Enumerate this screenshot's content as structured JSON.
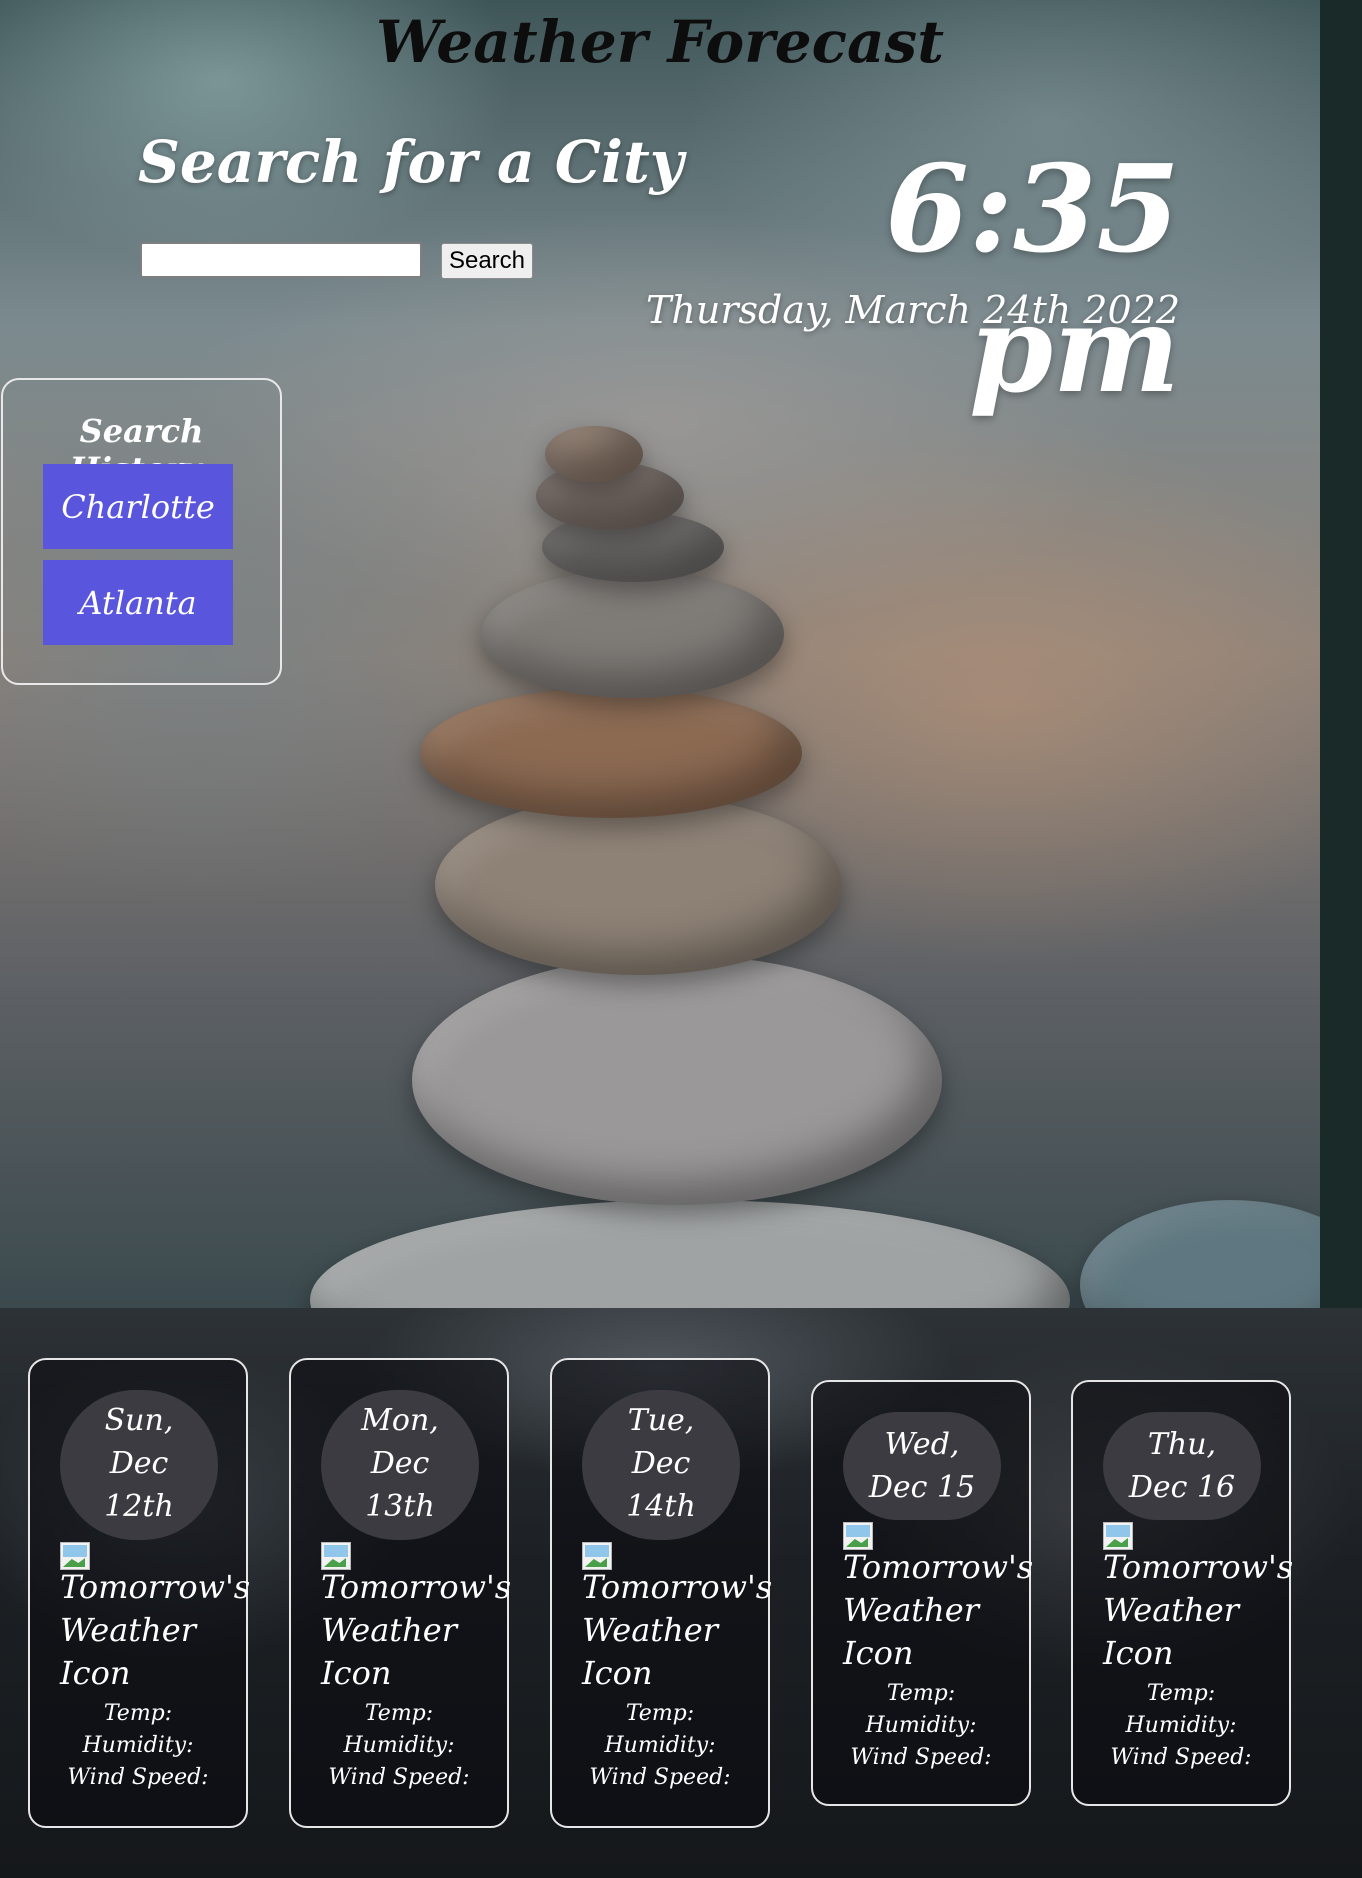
{
  "header": {
    "title": "Weather Forecast"
  },
  "search": {
    "heading": "Search for a City",
    "input_value": "",
    "input_placeholder": "",
    "button_label": "Search"
  },
  "clock": {
    "time": "6:35 pm",
    "date": "Thursday, March 24th 2022"
  },
  "history": {
    "title": "Search History:",
    "items": [
      {
        "label": "Charlotte"
      },
      {
        "label": "Atlanta"
      }
    ]
  },
  "forecast": [
    {
      "date_lines": [
        "Sun,",
        "Dec",
        "12th"
      ],
      "icon_alt": "Tomorrow's Weather Icon",
      "temp_label": "Temp:",
      "humidity_label": "Humidity:",
      "wind_label": "Wind Speed:"
    },
    {
      "date_lines": [
        "Mon,",
        "Dec",
        "13th"
      ],
      "icon_alt": "Tomorrow's Weather Icon",
      "temp_label": "Temp:",
      "humidity_label": "Humidity:",
      "wind_label": "Wind Speed:"
    },
    {
      "date_lines": [
        "Tue,",
        "Dec",
        "14th"
      ],
      "icon_alt": "Tomorrow's Weather Icon",
      "temp_label": "Temp:",
      "humidity_label": "Humidity:",
      "wind_label": "Wind Speed:"
    },
    {
      "date_lines": [
        "Wed,",
        "Dec 15"
      ],
      "icon_alt": "Tomorrow's Weather Icon",
      "temp_label": "Temp:",
      "humidity_label": "Humidity:",
      "wind_label": "Wind Speed:"
    },
    {
      "date_lines": [
        "Thu,",
        "Dec 16"
      ],
      "icon_alt": "Tomorrow's Weather Icon",
      "temp_label": "Temp:",
      "humidity_label": "Humidity:",
      "wind_label": "Wind Speed:"
    }
  ],
  "colors": {
    "history_button": "#5a55dd",
    "date_bubble": "#3c3b42",
    "card_border": "#e6e6e6"
  }
}
